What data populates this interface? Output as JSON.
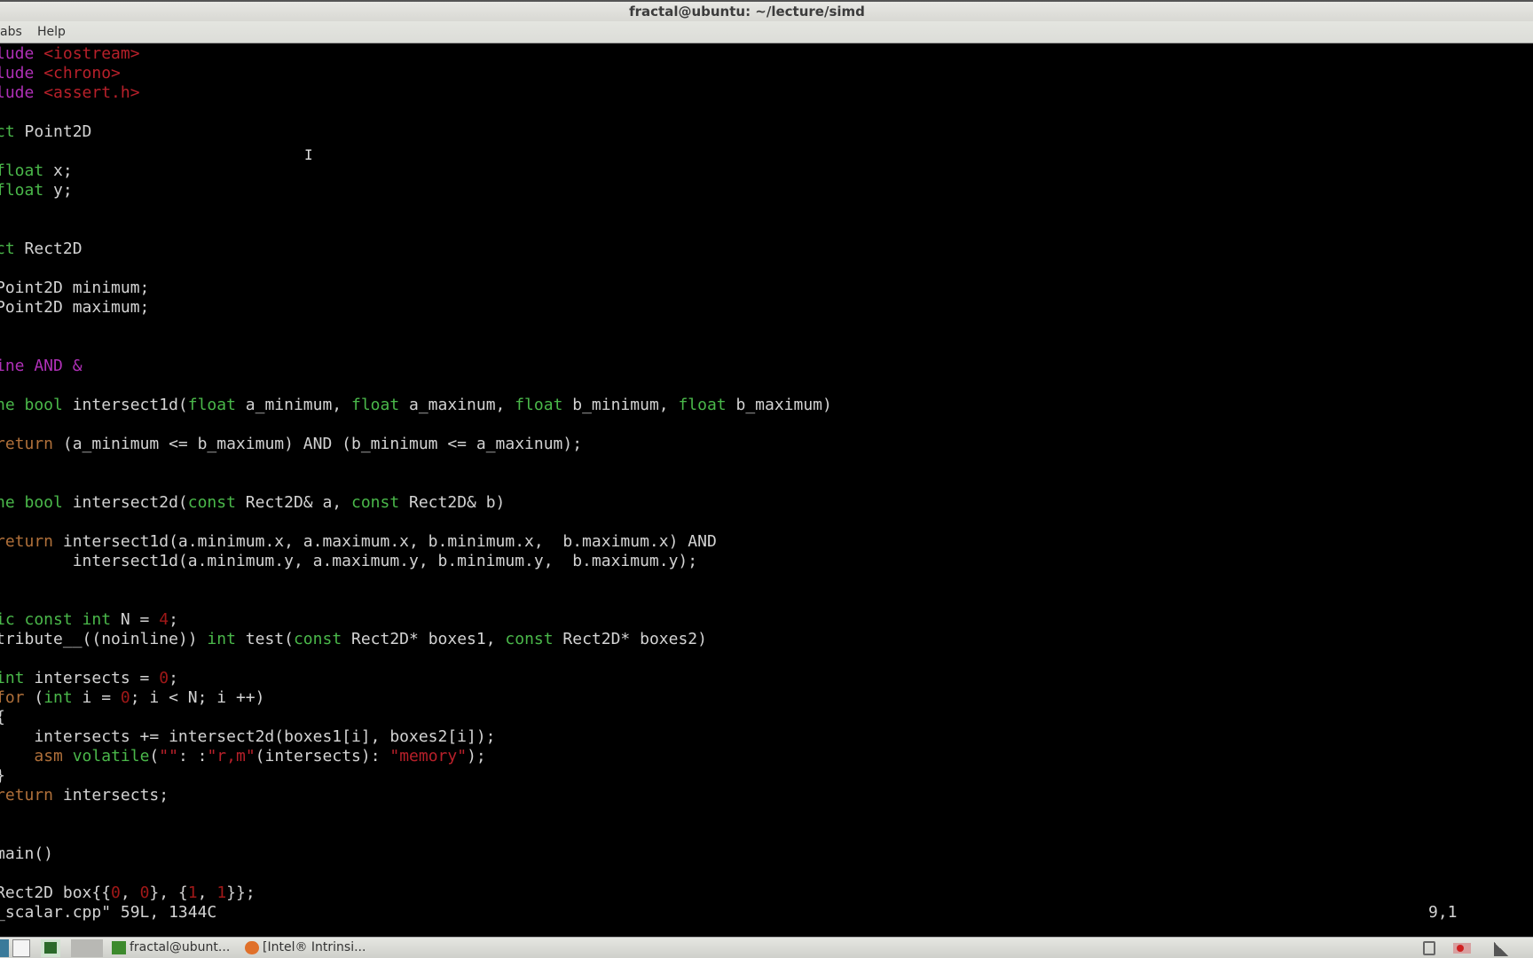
{
  "window": {
    "title": "fractal@ubuntu: ~/lecture/simd"
  },
  "menu": [
    "abs",
    "Help"
  ],
  "code_lines": [
    [
      [
        "pp",
        "lude"
      ],
      [
        "n",
        " "
      ],
      [
        "str",
        "<iostream>"
      ]
    ],
    [
      [
        "pp",
        "lude"
      ],
      [
        "n",
        " "
      ],
      [
        "str",
        "<chrono>"
      ]
    ],
    [
      [
        "pp",
        "lude"
      ],
      [
        "n",
        " "
      ],
      [
        "str",
        "<assert.h>"
      ]
    ],
    [],
    [
      [
        "type",
        "ct"
      ],
      [
        "n",
        " Point2D"
      ]
    ],
    [],
    [
      [
        "type",
        "float"
      ],
      [
        "n",
        " x;"
      ]
    ],
    [
      [
        "type",
        "float"
      ],
      [
        "n",
        " y;"
      ]
    ],
    [],
    [],
    [
      [
        "type",
        "ct"
      ],
      [
        "n",
        " Rect2D"
      ]
    ],
    [],
    [
      [
        "n",
        "Point2D minimum;"
      ]
    ],
    [
      [
        "n",
        "Point2D maximum;"
      ]
    ],
    [],
    [],
    [
      [
        "pp",
        "ine AND &"
      ]
    ],
    [],
    [
      [
        "type",
        "ne bool"
      ],
      [
        "n",
        " intersect1d("
      ],
      [
        "type",
        "float"
      ],
      [
        "n",
        " a_minimum, "
      ],
      [
        "type",
        "float"
      ],
      [
        "n",
        " a_maxinum, "
      ],
      [
        "type",
        "float"
      ],
      [
        "n",
        " b_minimum, "
      ],
      [
        "type",
        "float"
      ],
      [
        "n",
        " b_maximum)"
      ]
    ],
    [],
    [
      [
        "kw",
        "return"
      ],
      [
        "n",
        " (a_minimum <= b_maximum) AND (b_minimum <= a_maxinum);"
      ]
    ],
    [],
    [],
    [
      [
        "type",
        "ne bool"
      ],
      [
        "n",
        " intersect2d("
      ],
      [
        "type",
        "const"
      ],
      [
        "n",
        " Rect2D& a, "
      ],
      [
        "type",
        "const"
      ],
      [
        "n",
        " Rect2D& b)"
      ]
    ],
    [],
    [
      [
        "kw",
        "return"
      ],
      [
        "n",
        " intersect1d(a.minimum.x, a.maximum.x, b.minimum.x,  b.maximum.x) AND"
      ]
    ],
    [
      [
        "n",
        "        intersect1d(a.minimum.y, a.maximum.y, b.minimum.y,  b.maximum.y);"
      ]
    ],
    [],
    [],
    [
      [
        "type",
        "ic const int"
      ],
      [
        "n",
        " N = "
      ],
      [
        "num",
        "4"
      ],
      [
        "n",
        ";"
      ]
    ],
    [
      [
        "n",
        "tribute__((noinline)) "
      ],
      [
        "type",
        "int"
      ],
      [
        "n",
        " test("
      ],
      [
        "type",
        "const"
      ],
      [
        "n",
        " Rect2D* boxes1, "
      ],
      [
        "type",
        "const"
      ],
      [
        "n",
        " Rect2D* boxes2)"
      ]
    ],
    [],
    [
      [
        "type",
        "int"
      ],
      [
        "n",
        " intersects = "
      ],
      [
        "num",
        "0"
      ],
      [
        "n",
        ";"
      ]
    ],
    [
      [
        "kw",
        "for"
      ],
      [
        "n",
        " ("
      ],
      [
        "type",
        "int"
      ],
      [
        "n",
        " i = "
      ],
      [
        "num",
        "0"
      ],
      [
        "n",
        "; i < N; i ++)"
      ]
    ],
    [
      [
        "n",
        "{"
      ]
    ],
    [
      [
        "n",
        "    intersects += intersect2d(boxes1[i], boxes2[i]);"
      ]
    ],
    [
      [
        "n",
        "    "
      ],
      [
        "kw",
        "asm"
      ],
      [
        "n",
        " "
      ],
      [
        "type",
        "volatile"
      ],
      [
        "n",
        "("
      ],
      [
        "str",
        "\"\""
      ],
      [
        "n",
        ": :"
      ],
      [
        "str",
        "\"r,m\""
      ],
      [
        "n",
        "(intersects): "
      ],
      [
        "str",
        "\"memory\""
      ],
      [
        "n",
        ");"
      ]
    ],
    [
      [
        "n",
        "}"
      ]
    ],
    [
      [
        "kw",
        "return"
      ],
      [
        "n",
        " intersects;"
      ]
    ],
    [],
    [],
    [
      [
        "n",
        "main()"
      ]
    ],
    [],
    [
      [
        "n",
        "Rect2D box{{"
      ],
      [
        "num",
        "0"
      ],
      [
        "n",
        ", "
      ],
      [
        "num",
        "0"
      ],
      [
        "n",
        "}, {"
      ],
      [
        "num",
        "1"
      ],
      [
        "n",
        ", "
      ],
      [
        "num",
        "1"
      ],
      [
        "n",
        "}};"
      ]
    ]
  ],
  "status": {
    "file_info": "_scalar.cpp\" 59L, 1344C",
    "cursor_pos": "9,1"
  },
  "taskbar": {
    "tasks": [
      {
        "label": "fractal@ubunt...",
        "icon": "terminal-icon"
      },
      {
        "label": "[Intel® Intrinsi...",
        "icon": "firefox-icon"
      }
    ],
    "tray": [
      "battery-icon",
      "recording-icon",
      "signal-icon"
    ]
  },
  "colors": {
    "preprocessor": "#b030b8",
    "string": "#b8202a",
    "type": "#4ab84a",
    "keyword": "#b0703a",
    "text": "#d3d3d3",
    "background": "#000000"
  }
}
